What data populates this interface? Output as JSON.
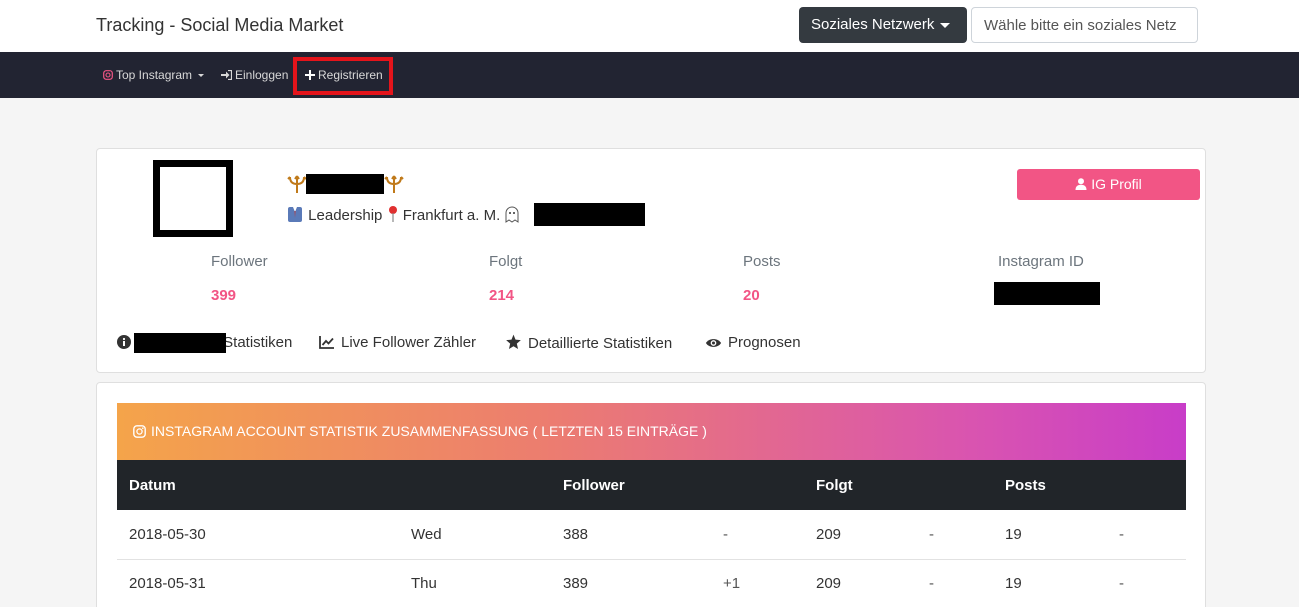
{
  "header": {
    "site_title": "Tracking - Social Media Market",
    "network_button": "Soziales Netzwerk",
    "network_placeholder": "Wähle bitte ein soziales Netz"
  },
  "navbar": {
    "items": [
      {
        "label": "Top Instagram",
        "icon": "instagram-icon"
      },
      {
        "label": "Einloggen",
        "icon": "sign-in-icon"
      },
      {
        "label": "Registrieren",
        "icon": "plus-icon"
      }
    ]
  },
  "profile": {
    "bio_leadership": "Leadership",
    "bio_location": "Frankfurt a. M.",
    "ig_profile_button": "IG Profil",
    "stats": [
      {
        "label": "Follower",
        "value": "399"
      },
      {
        "label": "Folgt",
        "value": "214"
      },
      {
        "label": "Posts",
        "value": "20"
      },
      {
        "label": "Instagram ID",
        "value": ""
      }
    ],
    "links": [
      {
        "label": "Statistiken",
        "icon": "info-icon"
      },
      {
        "label": "Live Follower Zähler",
        "icon": "chart-line-icon"
      },
      {
        "label": "Detaillierte Statistiken",
        "icon": "star-icon"
      },
      {
        "label": "Prognosen",
        "icon": "eye-icon"
      }
    ]
  },
  "summary": {
    "header": "INSTAGRAM ACCOUNT STATISTIK ZUSAMMENFASSUNG ( LETZTEN 15 EINTRÄGE )",
    "columns": [
      "Datum",
      "",
      "Follower",
      "",
      "Folgt",
      "",
      "Posts",
      ""
    ],
    "rows": [
      [
        "2018-05-30",
        "Wed",
        "388",
        "-",
        "209",
        "-",
        "19",
        "-"
      ],
      [
        "2018-05-31",
        "Thu",
        "389",
        "+1",
        "209",
        "-",
        "19",
        "-"
      ]
    ]
  },
  "colors": {
    "accent_pink": "#f25585",
    "navbar_bg": "#222432",
    "highlight_red": "#e4141b"
  }
}
